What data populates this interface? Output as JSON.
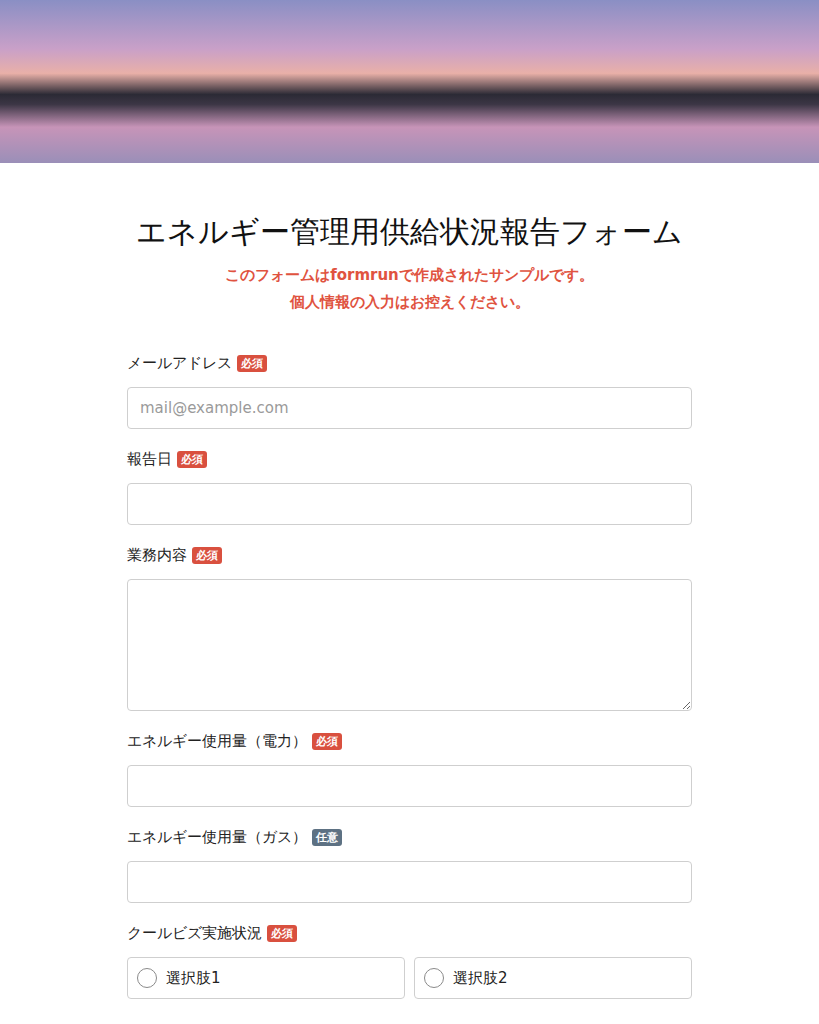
{
  "header": {
    "image": "sunset-lake"
  },
  "title": "エネルギー管理用供給状況報告フォーム",
  "notice": [
    "このフォームはformrunで作成されたサンプルです。",
    "個人情報の入力はお控えください。"
  ],
  "fields": [
    {
      "label": "メールアドレス",
      "badge": "必須",
      "required": true,
      "kind": "input",
      "placeholder": "mail@example.com"
    },
    {
      "label": "報告日",
      "badge": "必須",
      "required": true,
      "kind": "input",
      "placeholder": ""
    },
    {
      "label": "業務内容",
      "badge": "必須",
      "required": true,
      "kind": "textarea",
      "placeholder": ""
    },
    {
      "label": "エネルギー使用量（電力）",
      "badge": "必須",
      "required": true,
      "kind": "input",
      "placeholder": ""
    },
    {
      "label": "エネルギー使用量（ガス）",
      "badge": "任意",
      "required": false,
      "kind": "input",
      "placeholder": ""
    },
    {
      "label": "クールビズ実施状況",
      "badge": "必須",
      "required": true,
      "kind": "radio",
      "placeholder": "",
      "options": [
        {
          "label": "選択肢1",
          "selected": false
        },
        {
          "label": "選択肢2",
          "selected": false
        }
      ]
    }
  ]
}
